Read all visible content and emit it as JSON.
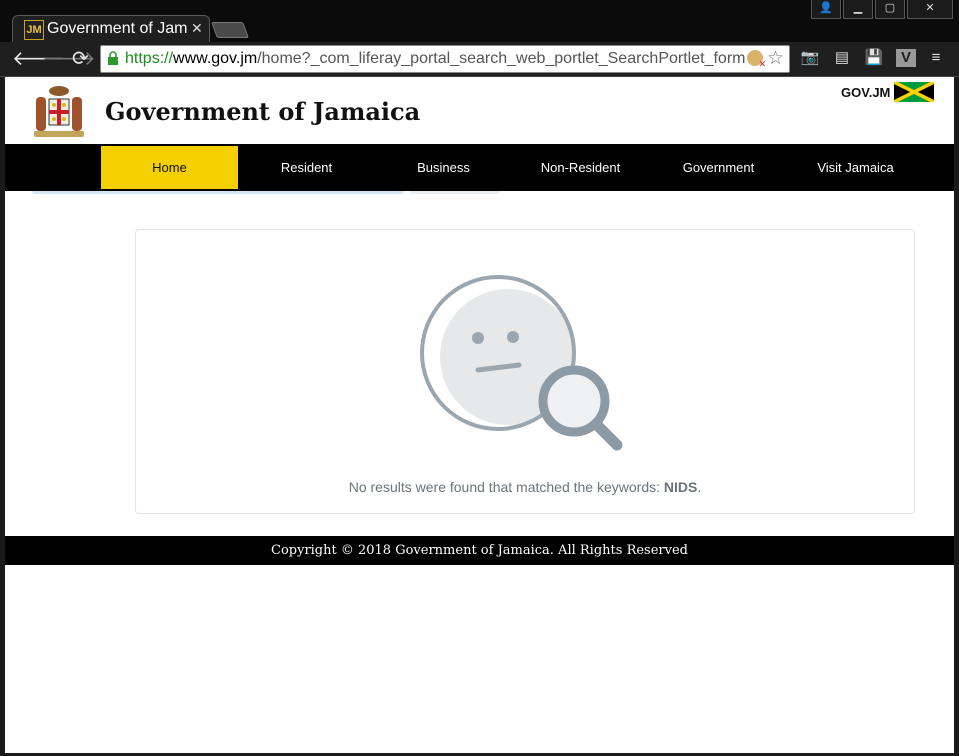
{
  "browser": {
    "tab_title": "Government of Jam",
    "favicon_text": "JM",
    "url_scheme": "https://",
    "url_host": "www.gov.jm",
    "url_path": "/home?_com_liferay_portal_search_web_portlet_SearchPortlet_formD",
    "window_controls": [
      "person-icon",
      "minimize-icon",
      "maximize-icon",
      "close-icon"
    ]
  },
  "header": {
    "site_title": "Government of Jamaica",
    "domain_label": "GOV.JM"
  },
  "nav": {
    "items": [
      {
        "label": "Home",
        "active": true
      },
      {
        "label": "Resident",
        "active": false
      },
      {
        "label": "Business",
        "active": false
      },
      {
        "label": "Non-Resident",
        "active": false
      },
      {
        "label": "Government",
        "active": false
      },
      {
        "label": "Visit Jamaica",
        "active": false
      }
    ]
  },
  "search": {
    "message": "No results were found that matched the keywords:",
    "keyword": "NIDS",
    "suffix": "."
  },
  "footer": {
    "text": "Copyright © 2018 Government of Jamaica. All Rights Reserved"
  },
  "colors": {
    "nav_active": "#f5d000",
    "nav_bg": "#000000",
    "flag_green": "#009b3a",
    "flag_gold": "#fed100"
  }
}
